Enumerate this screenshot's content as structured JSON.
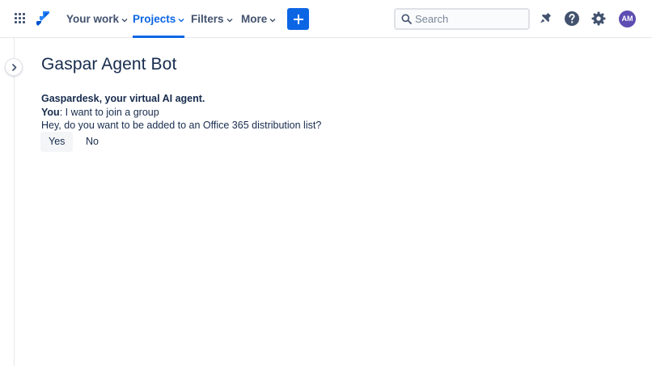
{
  "header": {
    "nav": [
      {
        "label": "Your work",
        "active": false
      },
      {
        "label": "Projects",
        "active": true
      },
      {
        "label": "Filters",
        "active": false
      },
      {
        "label": "More",
        "active": false
      }
    ],
    "search": {
      "placeholder": "Search",
      "value": ""
    },
    "avatar_initials": "AM",
    "icons": [
      "app-switcher-icon",
      "jira-logo-icon",
      "chevron-down-icon",
      "plus-icon",
      "search-icon",
      "notification-icon",
      "help-icon",
      "settings-icon"
    ]
  },
  "page": {
    "title": "Gaspar Agent Bot"
  },
  "chat": {
    "agent_intro": "Gaspardesk, your virtual AI agent.",
    "user_label": "You",
    "user_message": ": I want to join a group",
    "bot_message": "Hey, do you want to be added to an Office 365 distribution list?",
    "replies": [
      "Yes",
      "No"
    ]
  },
  "colors": {
    "accent": "#0c66e4",
    "text": "#172b4d",
    "subtle_text": "#42526e",
    "avatar": "#5e4db2",
    "border": "#e4e6ea",
    "reply_bg": "#f4f5f7"
  }
}
